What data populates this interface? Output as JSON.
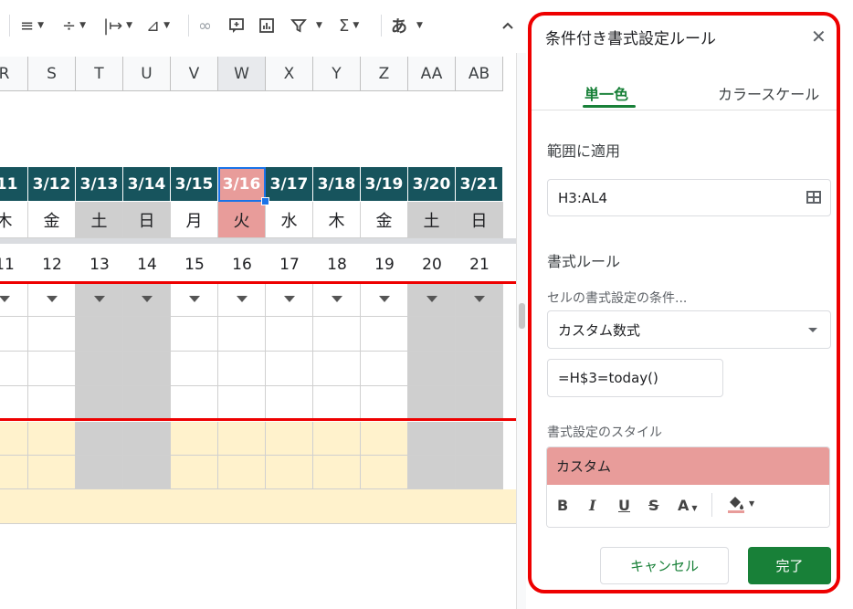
{
  "toolbar": {
    "items": [
      "align-horizontal-icon",
      "align-vertical-icon",
      "text-wrap-icon",
      "text-rotate-icon",
      "link-icon",
      "comment-icon",
      "chart-icon",
      "filter-icon",
      "functions-icon",
      "input-tools-icon",
      "collapse-icon"
    ],
    "input_tools_label": "あ"
  },
  "sheet": {
    "columns": [
      "R",
      "S",
      "T",
      "U",
      "V",
      "W",
      "X",
      "Y",
      "Z",
      "AA",
      "AB"
    ],
    "selected_column": "W",
    "dates": [
      "/11",
      "3/12",
      "3/13",
      "3/14",
      "3/15",
      "3/16",
      "3/17",
      "3/18",
      "3/19",
      "3/20",
      "3/21"
    ],
    "weekdays": [
      "木",
      "金",
      "土",
      "日",
      "月",
      "火",
      "水",
      "木",
      "金",
      "土",
      "日"
    ],
    "numbers": [
      "11",
      "12",
      "13",
      "14",
      "15",
      "16",
      "17",
      "18",
      "19",
      "20",
      "21"
    ],
    "weekend_columns": [
      "T",
      "U",
      "AA",
      "AB"
    ],
    "highlight_column": "W",
    "colors": {
      "header_teal": "#17545d",
      "highlight": "#e89c9a",
      "weekend": "#cfcfcf",
      "yellow": "#fff2cc",
      "red_line": "#e00000"
    }
  },
  "panel": {
    "title": "条件付き書式設定ルール",
    "tabs": [
      {
        "label": "単一色",
        "active": true
      },
      {
        "label": "カラースケール",
        "active": false
      }
    ],
    "range_label": "範囲に適用",
    "range_value": "H3:AL4",
    "rules_label": "書式ルール",
    "condition_label": "セルの書式設定の条件...",
    "condition_value": "カスタム数式",
    "formula_value": "=H$3=today()",
    "style_label": "書式設定のスタイル",
    "style_preview": "カスタム",
    "style_buttons": {
      "bold": "B",
      "italic": "I",
      "underline": "U",
      "strike": "S",
      "text_color": "A"
    },
    "cancel_label": "キャンセル",
    "done_label": "完了",
    "accent_color": "#188038",
    "highlight_border_color": "#e00000"
  }
}
